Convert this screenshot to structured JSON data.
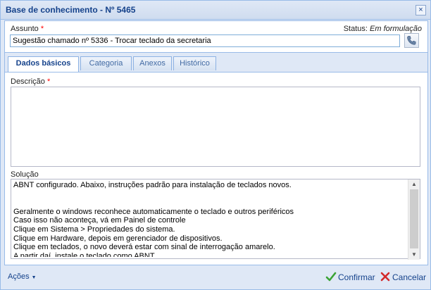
{
  "window": {
    "title": "Base de conhecimento - Nº 5465",
    "close_label": "×"
  },
  "subject": {
    "label": "Assunto",
    "required_mark": "*",
    "value": "Sugestão chamado nº 5336 - Trocar teclado da secretaria",
    "status_label": "Status:",
    "status_value": "Em formulação"
  },
  "tabs": [
    {
      "label": "Dados básicos",
      "active": true
    },
    {
      "label": "Categoria",
      "active": false
    },
    {
      "label": "Anexos",
      "active": false
    },
    {
      "label": "Histórico",
      "active": false
    }
  ],
  "description": {
    "label": "Descrição",
    "required_mark": "*",
    "value": ""
  },
  "solution": {
    "label": "Solução",
    "value": "ABNT configurado. Abaixo, instruções padrão para instalação de teclados novos.\n\n\nGeralmente o windows reconhece automaticamente o teclado e outros periféricos\nCaso isso não aconteça, vá em Painel de controle\nClique em Sistema > Propriedades do sistema.\nClique em Hardware, depois em gerenciador de dispositivos.\nClique em teclados, o novo deverá estar com sinal de interrogação amarelo.\nA partir daí, instale o teclado como ABNT"
  },
  "footer": {
    "actions_label": "Ações",
    "confirm_label": "Confirmar",
    "cancel_label": "Cancelar"
  },
  "colors": {
    "accent": "#15428b",
    "required": "#ff0000",
    "confirm_icon": "#3aa335",
    "cancel_icon": "#d32a2a"
  }
}
